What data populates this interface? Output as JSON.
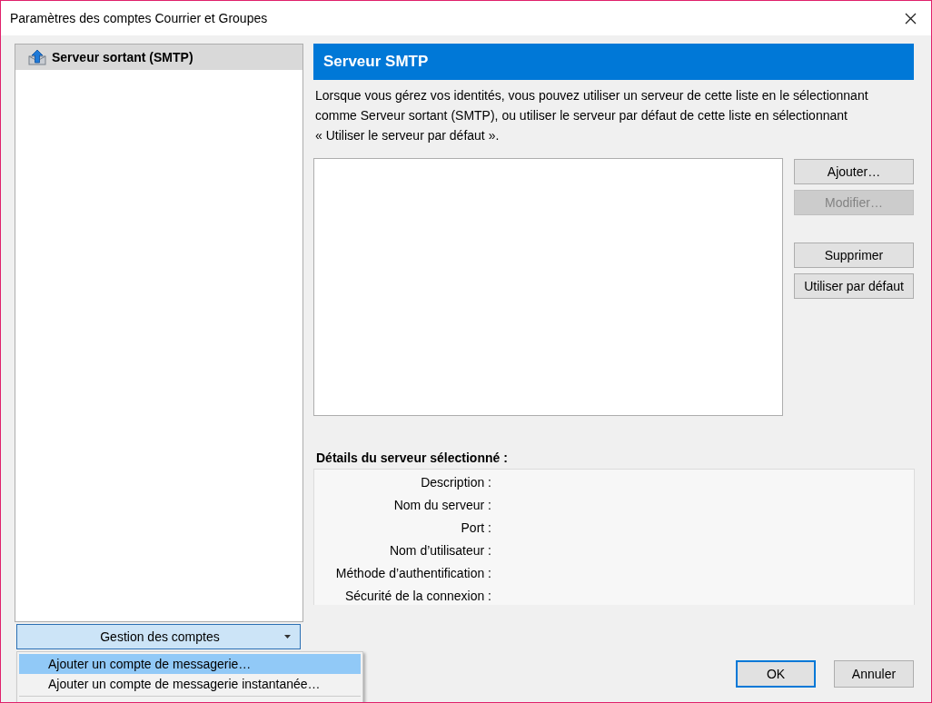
{
  "window": {
    "title": "Paramètres des comptes Courrier et Groupes"
  },
  "sidebar": {
    "items": [
      {
        "label": "Serveur sortant (SMTP)",
        "selected": true
      }
    ],
    "account_button": {
      "label": "Gestion des comptes",
      "pressed": true
    }
  },
  "account_menu": {
    "items": [
      {
        "label": "Ajouter un compte de messagerie…",
        "selected": true
      },
      {
        "label": "Ajouter un compte de messagerie instantanée…",
        "selected": false
      }
    ]
  },
  "panel": {
    "header": "Serveur SMTP",
    "description": "Lorsque vous gérez vos identités, vous pouvez utiliser un serveur de cette liste en le sélectionnant\ncomme Serveur sortant (SMTP), ou utiliser le serveur par défaut de cette liste en sélectionnant\n« Utiliser le serveur par défaut ».",
    "buttons": [
      {
        "label": "Ajouter…",
        "disabled": false
      },
      {
        "label": "Modifier…",
        "disabled": true
      },
      {
        "label": "Supprimer",
        "disabled": false
      },
      {
        "label": "Utiliser par défaut",
        "disabled": false
      }
    ],
    "details": {
      "title": "Détails du serveur sélectionné :",
      "fields": [
        {
          "label": "Description :"
        },
        {
          "label": "Nom du serveur :"
        },
        {
          "label": "Port :"
        },
        {
          "label": "Nom d’utilisateur :"
        },
        {
          "label": "Méthode d’authentification :"
        },
        {
          "label": "Sécurité de la connexion :"
        }
      ]
    }
  },
  "dialog_buttons": [
    {
      "label": "OK",
      "default": true
    },
    {
      "label": "Annuler",
      "default": false
    }
  ]
}
